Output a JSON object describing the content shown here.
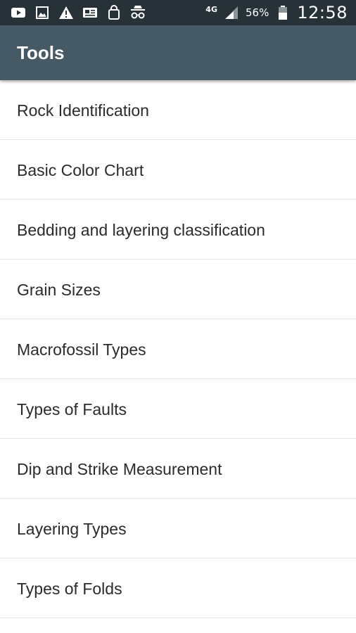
{
  "status_bar": {
    "icons_left": [
      "youtube-icon",
      "image-icon",
      "warning-icon",
      "news-icon",
      "shopping-bag-icon",
      "incognito-icon"
    ],
    "network": "4G",
    "battery_percent": "56%",
    "time": "12:58"
  },
  "app_bar": {
    "title": "Tools"
  },
  "tools": [
    {
      "label": "Rock Identification"
    },
    {
      "label": "Basic Color Chart"
    },
    {
      "label": "Bedding and layering classification"
    },
    {
      "label": "Grain Sizes"
    },
    {
      "label": "Macrofossil Types"
    },
    {
      "label": "Types of Faults"
    },
    {
      "label": "Dip and Strike Measurement"
    },
    {
      "label": "Layering Types"
    },
    {
      "label": "Types of Folds"
    }
  ],
  "colors": {
    "status_bar": "#263238",
    "app_bar": "#455a64",
    "divider": "#e6e6e6",
    "text": "#2b2b2b"
  }
}
